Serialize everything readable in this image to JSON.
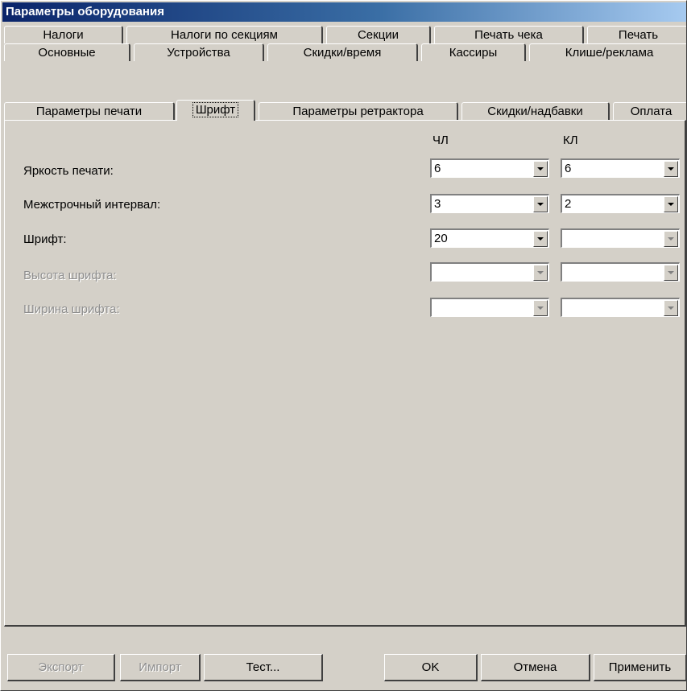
{
  "window": {
    "title": "Параметры оборудования"
  },
  "tabs": {
    "row1": [
      "Налоги",
      "Налоги по секциям",
      "Секции",
      "Печать чека",
      "Печать"
    ],
    "row2": [
      "Основные",
      "Устройства",
      "Скидки/время",
      "Кассиры",
      "Клише/реклама"
    ],
    "row3": [
      "Параметры печати",
      "Шрифт",
      "Параметры ретрактора",
      "Скидки/надбавки",
      "Оплата"
    ],
    "active": "Шрифт"
  },
  "columns": {
    "chl": "ЧЛ",
    "kl": "КЛ"
  },
  "fields": [
    {
      "label": "Яркость печати:",
      "chl": "6",
      "kl": "6",
      "enabled": true
    },
    {
      "label": "Межстрочный интервал:",
      "chl": "3",
      "kl": "2",
      "enabled": true
    },
    {
      "label": "Шрифт:",
      "chl": "20",
      "kl": "",
      "enabled": true
    },
    {
      "label": "Высота шрифта:",
      "chl": "",
      "kl": "",
      "enabled": false
    },
    {
      "label": "Ширина шрифта:",
      "chl": "",
      "kl": "",
      "enabled": false
    }
  ],
  "buttons": {
    "export": "Экспорт",
    "import": "Импорт",
    "test": "Тест...",
    "ok": "OK",
    "cancel": "Отмена",
    "apply": "Применить"
  },
  "icons": {
    "dropdown": "chevron-down-icon"
  },
  "colors": {
    "face": "#d4d0c8",
    "title_start": "#0a246a",
    "title_end": "#a6caf0",
    "disabled_text": "#8e8e8e"
  }
}
